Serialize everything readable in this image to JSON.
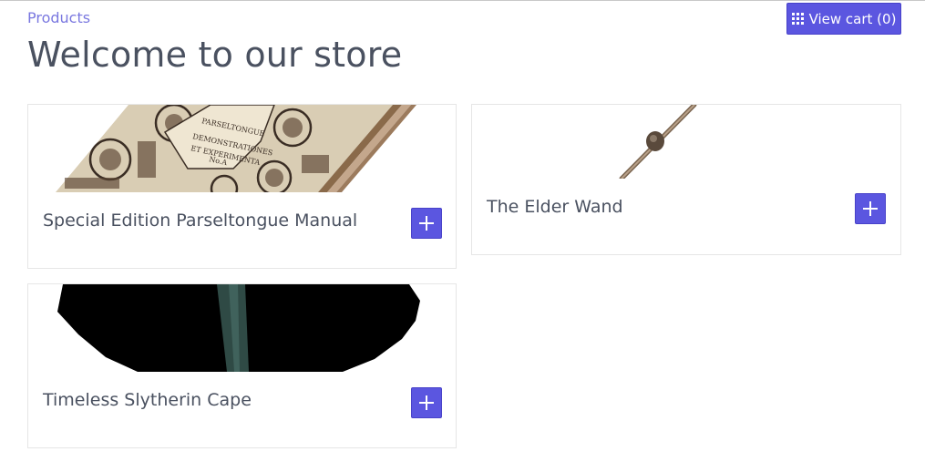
{
  "header": {
    "breadcrumb": "Products",
    "title": "Welcome to our store",
    "cart_button": {
      "label": "View cart (0)",
      "icon": "grid-icon"
    }
  },
  "products": [
    {
      "name": "Special Edition Parseltongue Manual",
      "image": "parseltongue-book-image",
      "add_icon": "plus-icon"
    },
    {
      "name": "The Elder Wand",
      "image": "elder-wand-image",
      "add_icon": "plus-icon"
    },
    {
      "name": "Timeless Slytherin Cape",
      "image": "slytherin-cape-image",
      "add_icon": "plus-icon"
    }
  ],
  "colors": {
    "accent": "#5b56e0",
    "link": "#7a78e0",
    "text": "#4a5160",
    "card_border": "#e6e6e6"
  }
}
